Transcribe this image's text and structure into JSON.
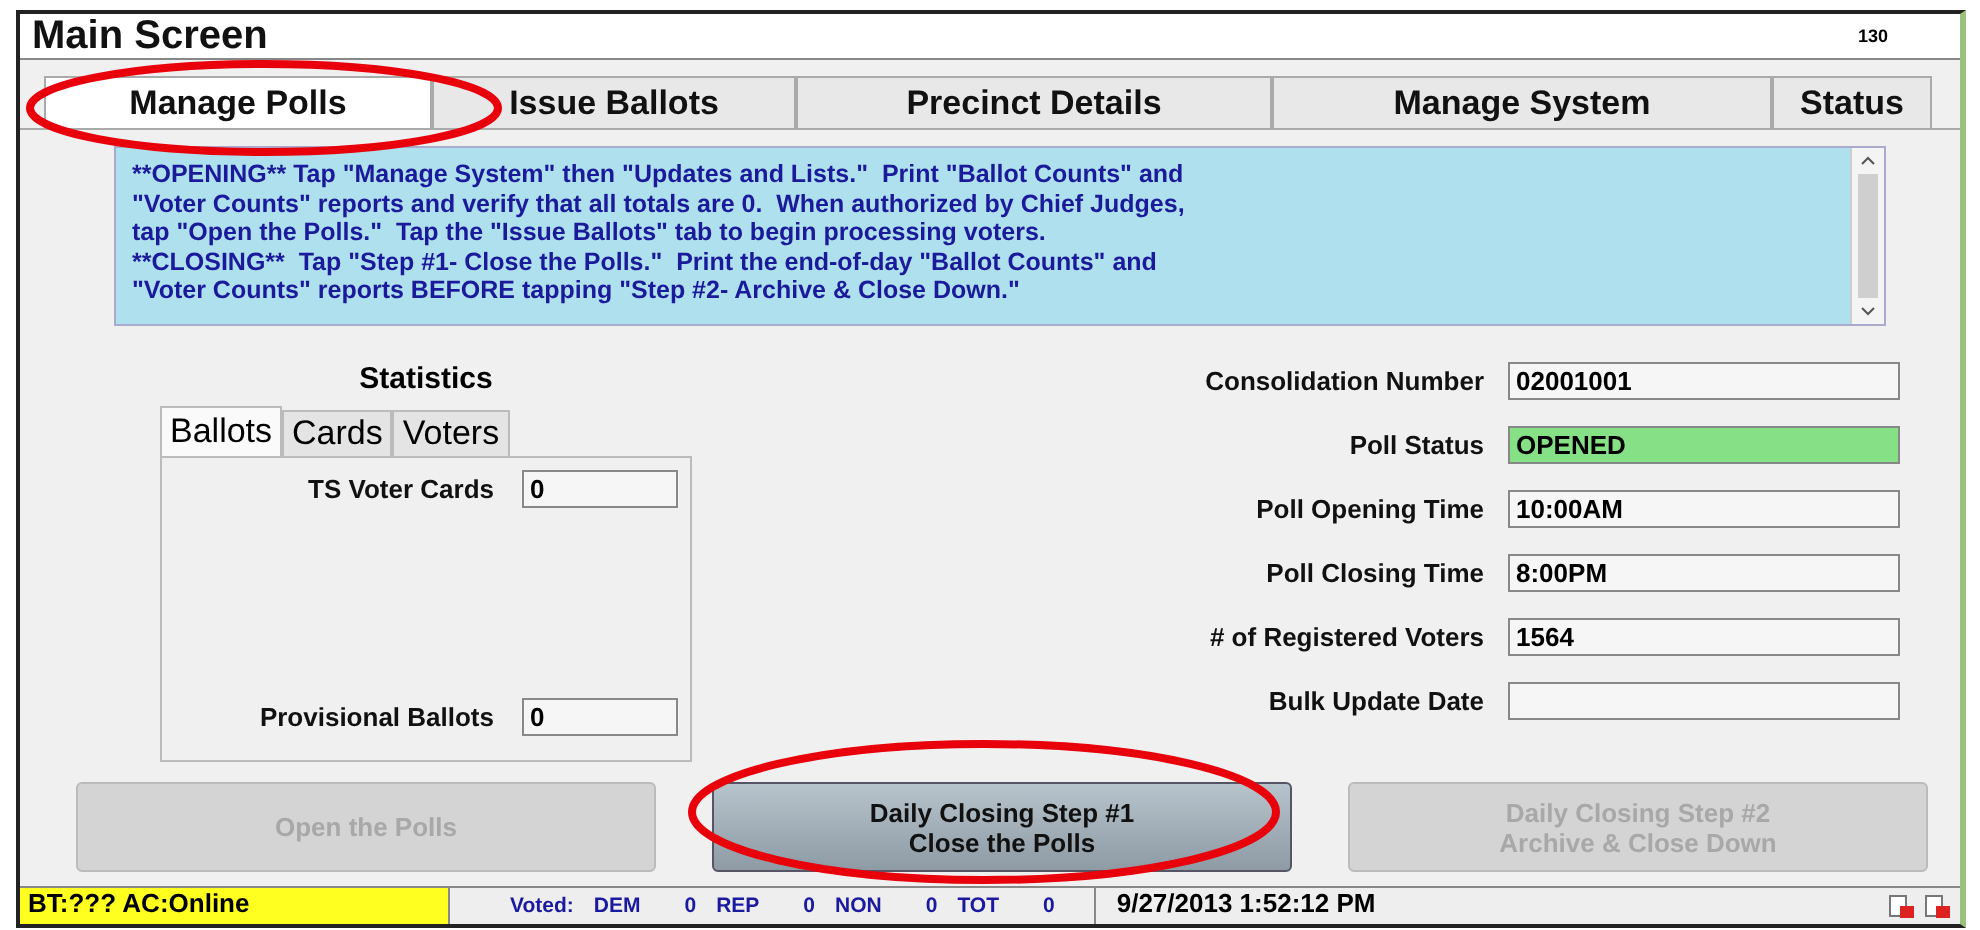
{
  "window": {
    "title": "Main Screen",
    "code": "130"
  },
  "tabs": [
    {
      "label": "Manage Polls",
      "selected": true
    },
    {
      "label": "Issue Ballots",
      "selected": false
    },
    {
      "label": "Precinct Details",
      "selected": false
    },
    {
      "label": "Manage System",
      "selected": false
    },
    {
      "label": "Status",
      "selected": false
    }
  ],
  "instructions": "**OPENING** Tap \"Manage System\" then \"Updates and Lists.\"  Print \"Ballot Counts\" and\n\"Voter Counts\" reports and verify that all totals are 0.  When authorized by Chief Judges,\ntap \"Open the Polls.\"  Tap the \"Issue Ballots\" tab to begin processing voters.\n**CLOSING**  Tap \"Step #1- Close the Polls.\"  Print the end-of-day \"Ballot Counts\" and\n\"Voter Counts\" reports BEFORE tapping \"Step #2- Archive & Close Down.\"",
  "statistics": {
    "title": "Statistics",
    "tabs": [
      {
        "label": "Ballots",
        "selected": true
      },
      {
        "label": "Cards",
        "selected": false
      },
      {
        "label": "Voters",
        "selected": false
      }
    ],
    "fields": [
      {
        "label": "TS Voter Cards",
        "value": "0"
      },
      {
        "label": "Provisional Ballots",
        "value": "0"
      }
    ]
  },
  "details": [
    {
      "label": "Consolidation Number",
      "value": "02001001",
      "highlight": false
    },
    {
      "label": "Poll Status",
      "value": "OPENED",
      "highlight": true
    },
    {
      "label": "Poll Opening Time",
      "value": "10:00AM",
      "highlight": false
    },
    {
      "label": "Poll Closing Time",
      "value": "8:00PM",
      "highlight": false
    },
    {
      "label": "# of Registered Voters",
      "value": "1564",
      "highlight": false
    },
    {
      "label": "Bulk Update Date",
      "highlight": false
    }
  ],
  "buttons": [
    {
      "lines": [
        "Open the Polls"
      ],
      "disabled": true
    },
    {
      "lines": [
        "Daily Closing Step #1",
        "Close the Polls"
      ],
      "disabled": false
    },
    {
      "lines": [
        "Daily Closing Step #2",
        "Archive & Close Down"
      ],
      "disabled": true
    }
  ],
  "status_bar": {
    "connection": "BT:??? AC:Online",
    "voted_label": "Voted:",
    "counts": [
      {
        "party": "DEM",
        "count": "0"
      },
      {
        "party": "REP",
        "count": "0"
      },
      {
        "party": "NON",
        "count": "0"
      },
      {
        "party": "TOT",
        "count": "0"
      }
    ],
    "datetime": "9/27/2013 1:52:12 PM"
  }
}
